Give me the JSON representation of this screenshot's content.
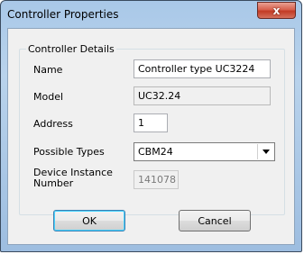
{
  "window": {
    "title": "Controller Properties",
    "close_glyph": "x"
  },
  "group": {
    "legend": "Controller Details"
  },
  "fields": {
    "name_label": "Name",
    "name_value": "Controller type UC3224",
    "model_label": "Model",
    "model_value": "UC32.24",
    "address_label": "Address",
    "address_value": "1",
    "types_label": "Possible Types",
    "types_value": "CBM24",
    "instance_label": "Device Instance Number",
    "instance_value": "141078"
  },
  "buttons": {
    "ok": "OK",
    "cancel": "Cancel"
  },
  "icons": {
    "close": "close-icon",
    "dropdown": "chevron-down-icon"
  }
}
